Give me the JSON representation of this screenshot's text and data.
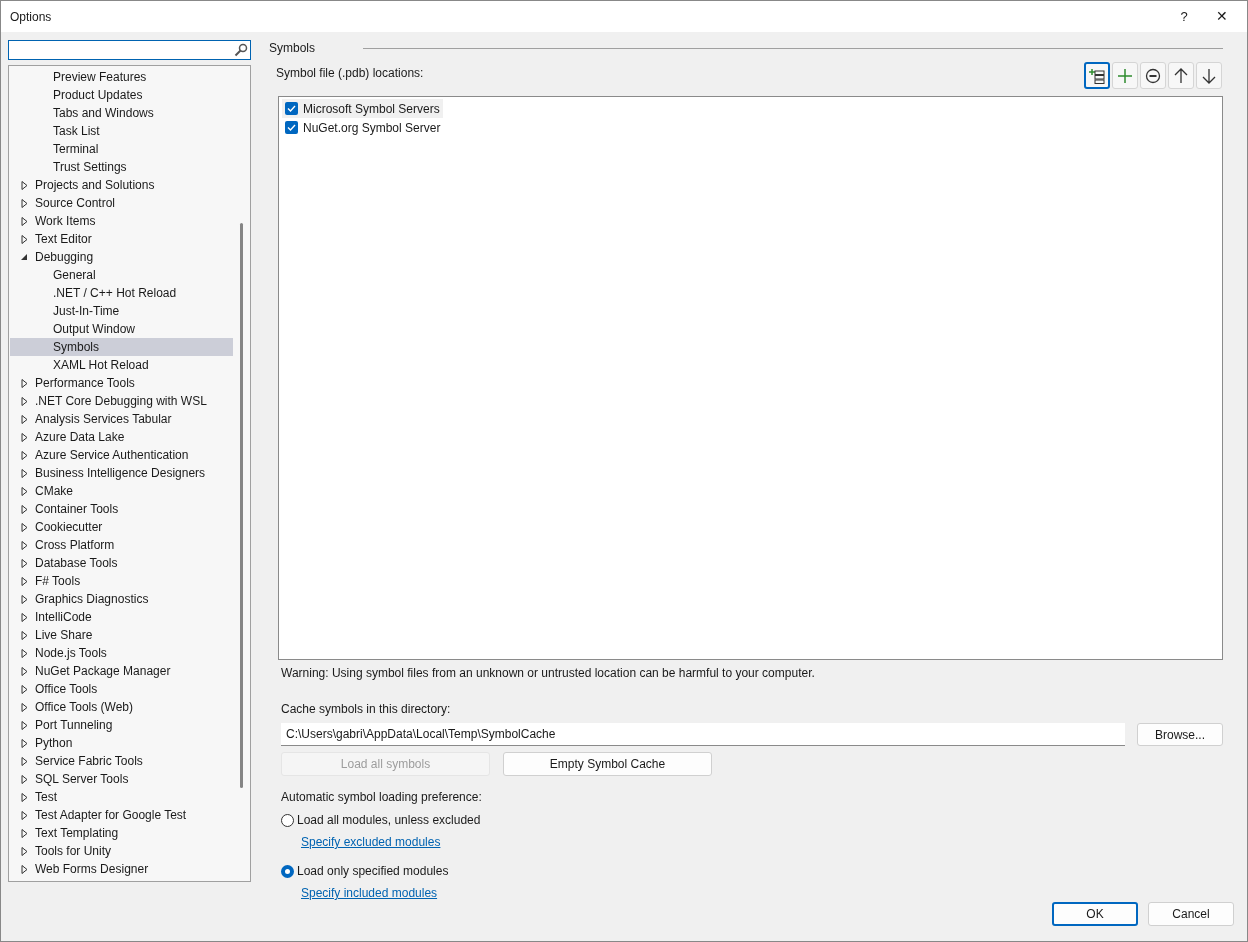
{
  "window": {
    "title": "Options",
    "help": "?",
    "close": "✕"
  },
  "tree": {
    "continued_items": [
      {
        "label": "Preview Features",
        "selected": false
      },
      {
        "label": "Product Updates",
        "selected": false
      },
      {
        "label": "Tabs and Windows",
        "selected": false
      },
      {
        "label": "Task List",
        "selected": false
      },
      {
        "label": "Terminal",
        "selected": false
      },
      {
        "label": "Trust Settings",
        "selected": false
      }
    ],
    "items": [
      {
        "label": "Projects and Solutions",
        "expanded": false,
        "selected": false
      },
      {
        "label": "Source Control",
        "expanded": false,
        "selected": false
      },
      {
        "label": "Work Items",
        "expanded": false,
        "selected": false
      },
      {
        "label": "Text Editor",
        "expanded": false,
        "selected": false
      },
      {
        "label": "Debugging",
        "expanded": true,
        "selected": false,
        "children": [
          {
            "label": "General",
            "selected": false
          },
          {
            "label": ".NET / C++ Hot Reload",
            "selected": false
          },
          {
            "label": "Just-In-Time",
            "selected": false
          },
          {
            "label": "Output Window",
            "selected": false
          },
          {
            "label": "Symbols",
            "selected": true
          },
          {
            "label": "XAML Hot Reload",
            "selected": false
          }
        ]
      },
      {
        "label": "Performance Tools",
        "expanded": false,
        "selected": false
      },
      {
        "label": ".NET Core Debugging with WSL",
        "expanded": false,
        "selected": false
      },
      {
        "label": "Analysis Services Tabular",
        "expanded": false,
        "selected": false
      },
      {
        "label": "Azure Data Lake",
        "expanded": false,
        "selected": false
      },
      {
        "label": "Azure Service Authentication",
        "expanded": false,
        "selected": false
      },
      {
        "label": "Business Intelligence Designers",
        "expanded": false,
        "selected": false
      },
      {
        "label": "CMake",
        "expanded": false,
        "selected": false
      },
      {
        "label": "Container Tools",
        "expanded": false,
        "selected": false
      },
      {
        "label": "Cookiecutter",
        "expanded": false,
        "selected": false
      },
      {
        "label": "Cross Platform",
        "expanded": false,
        "selected": false
      },
      {
        "label": "Database Tools",
        "expanded": false,
        "selected": false
      },
      {
        "label": "F# Tools",
        "expanded": false,
        "selected": false
      },
      {
        "label": "Graphics Diagnostics",
        "expanded": false,
        "selected": false
      },
      {
        "label": "IntelliCode",
        "expanded": false,
        "selected": false
      },
      {
        "label": "Live Share",
        "expanded": false,
        "selected": false
      },
      {
        "label": "Node.js Tools",
        "expanded": false,
        "selected": false
      },
      {
        "label": "NuGet Package Manager",
        "expanded": false,
        "selected": false
      },
      {
        "label": "Office Tools",
        "expanded": false,
        "selected": false
      },
      {
        "label": "Office Tools (Web)",
        "expanded": false,
        "selected": false
      },
      {
        "label": "Port Tunneling",
        "expanded": false,
        "selected": false
      },
      {
        "label": "Python",
        "expanded": false,
        "selected": false
      },
      {
        "label": "Service Fabric Tools",
        "expanded": false,
        "selected": false
      },
      {
        "label": "SQL Server Tools",
        "expanded": false,
        "selected": false
      },
      {
        "label": "Test",
        "expanded": false,
        "selected": false
      },
      {
        "label": "Test Adapter for Google Test",
        "expanded": false,
        "selected": false
      },
      {
        "label": "Text Templating",
        "expanded": false,
        "selected": false
      },
      {
        "label": "Tools for Unity",
        "expanded": false,
        "selected": false
      },
      {
        "label": "Web Forms Designer",
        "expanded": false,
        "selected": false
      }
    ]
  },
  "section_title": "Symbols",
  "locations_label": "Symbol file (.pdb) locations:",
  "toolbar": [
    {
      "kind": "add-folder",
      "disabled": false,
      "selected": true
    },
    {
      "kind": "add",
      "disabled": false,
      "selected": false
    },
    {
      "kind": "remove",
      "disabled": false,
      "selected": false
    },
    {
      "kind": "up",
      "disabled": false,
      "selected": false
    },
    {
      "kind": "down",
      "disabled": false,
      "selected": false
    }
  ],
  "locations": [
    {
      "label": "Microsoft Symbol Servers",
      "checked": true,
      "selected": true
    },
    {
      "label": "NuGet.org Symbol Server",
      "checked": true,
      "selected": false
    }
  ],
  "warning": "Warning: Using symbol files from an unknown or untrusted location can be harmful to your computer.",
  "cache_label": "Cache symbols in this directory:",
  "cache_path": "C:\\Users\\gabri\\AppData\\Local\\Temp\\SymbolCache",
  "browse_button": "Browse...",
  "action_buttons": [
    {
      "label": "Load all symbols",
      "disabled": true
    },
    {
      "label": "Empty Symbol Cache",
      "disabled": false
    }
  ],
  "loading_label": "Automatic symbol loading preference:",
  "loading_options": [
    {
      "label": "Load all modules, unless excluded",
      "selected": false,
      "link": "Specify excluded modules"
    },
    {
      "label": "Load only specified modules",
      "selected": true,
      "link": "Specify included modules"
    }
  ],
  "dialog_buttons": [
    {
      "label": "OK",
      "default": true
    },
    {
      "label": "Cancel",
      "default": false
    }
  ]
}
